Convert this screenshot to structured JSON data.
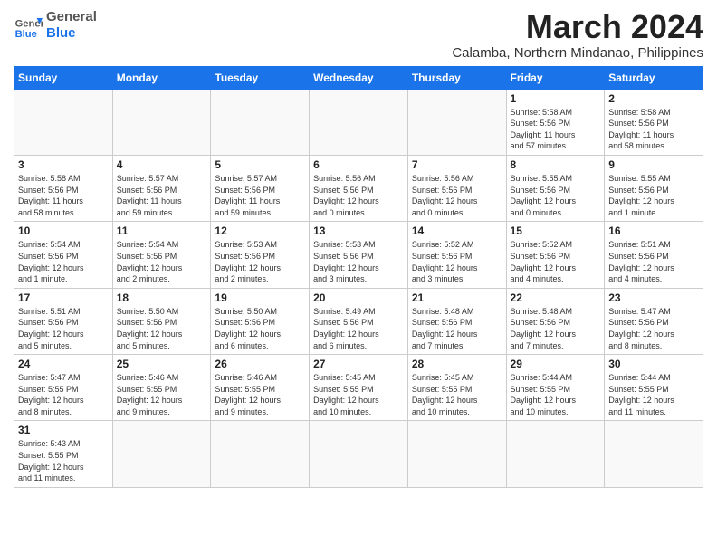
{
  "header": {
    "logo_general": "General",
    "logo_blue": "Blue",
    "month": "March 2024",
    "location": "Calamba, Northern Mindanao, Philippines"
  },
  "weekdays": [
    "Sunday",
    "Monday",
    "Tuesday",
    "Wednesday",
    "Thursday",
    "Friday",
    "Saturday"
  ],
  "weeks": [
    [
      {
        "day": "",
        "info": ""
      },
      {
        "day": "",
        "info": ""
      },
      {
        "day": "",
        "info": ""
      },
      {
        "day": "",
        "info": ""
      },
      {
        "day": "",
        "info": ""
      },
      {
        "day": "1",
        "info": "Sunrise: 5:58 AM\nSunset: 5:56 PM\nDaylight: 11 hours\nand 57 minutes."
      },
      {
        "day": "2",
        "info": "Sunrise: 5:58 AM\nSunset: 5:56 PM\nDaylight: 11 hours\nand 58 minutes."
      }
    ],
    [
      {
        "day": "3",
        "info": "Sunrise: 5:58 AM\nSunset: 5:56 PM\nDaylight: 11 hours\nand 58 minutes."
      },
      {
        "day": "4",
        "info": "Sunrise: 5:57 AM\nSunset: 5:56 PM\nDaylight: 11 hours\nand 59 minutes."
      },
      {
        "day": "5",
        "info": "Sunrise: 5:57 AM\nSunset: 5:56 PM\nDaylight: 11 hours\nand 59 minutes."
      },
      {
        "day": "6",
        "info": "Sunrise: 5:56 AM\nSunset: 5:56 PM\nDaylight: 12 hours\nand 0 minutes."
      },
      {
        "day": "7",
        "info": "Sunrise: 5:56 AM\nSunset: 5:56 PM\nDaylight: 12 hours\nand 0 minutes."
      },
      {
        "day": "8",
        "info": "Sunrise: 5:55 AM\nSunset: 5:56 PM\nDaylight: 12 hours\nand 0 minutes."
      },
      {
        "day": "9",
        "info": "Sunrise: 5:55 AM\nSunset: 5:56 PM\nDaylight: 12 hours\nand 1 minute."
      }
    ],
    [
      {
        "day": "10",
        "info": "Sunrise: 5:54 AM\nSunset: 5:56 PM\nDaylight: 12 hours\nand 1 minute."
      },
      {
        "day": "11",
        "info": "Sunrise: 5:54 AM\nSunset: 5:56 PM\nDaylight: 12 hours\nand 2 minutes."
      },
      {
        "day": "12",
        "info": "Sunrise: 5:53 AM\nSunset: 5:56 PM\nDaylight: 12 hours\nand 2 minutes."
      },
      {
        "day": "13",
        "info": "Sunrise: 5:53 AM\nSunset: 5:56 PM\nDaylight: 12 hours\nand 3 minutes."
      },
      {
        "day": "14",
        "info": "Sunrise: 5:52 AM\nSunset: 5:56 PM\nDaylight: 12 hours\nand 3 minutes."
      },
      {
        "day": "15",
        "info": "Sunrise: 5:52 AM\nSunset: 5:56 PM\nDaylight: 12 hours\nand 4 minutes."
      },
      {
        "day": "16",
        "info": "Sunrise: 5:51 AM\nSunset: 5:56 PM\nDaylight: 12 hours\nand 4 minutes."
      }
    ],
    [
      {
        "day": "17",
        "info": "Sunrise: 5:51 AM\nSunset: 5:56 PM\nDaylight: 12 hours\nand 5 minutes."
      },
      {
        "day": "18",
        "info": "Sunrise: 5:50 AM\nSunset: 5:56 PM\nDaylight: 12 hours\nand 5 minutes."
      },
      {
        "day": "19",
        "info": "Sunrise: 5:50 AM\nSunset: 5:56 PM\nDaylight: 12 hours\nand 6 minutes."
      },
      {
        "day": "20",
        "info": "Sunrise: 5:49 AM\nSunset: 5:56 PM\nDaylight: 12 hours\nand 6 minutes."
      },
      {
        "day": "21",
        "info": "Sunrise: 5:48 AM\nSunset: 5:56 PM\nDaylight: 12 hours\nand 7 minutes."
      },
      {
        "day": "22",
        "info": "Sunrise: 5:48 AM\nSunset: 5:56 PM\nDaylight: 12 hours\nand 7 minutes."
      },
      {
        "day": "23",
        "info": "Sunrise: 5:47 AM\nSunset: 5:56 PM\nDaylight: 12 hours\nand 8 minutes."
      }
    ],
    [
      {
        "day": "24",
        "info": "Sunrise: 5:47 AM\nSunset: 5:55 PM\nDaylight: 12 hours\nand 8 minutes."
      },
      {
        "day": "25",
        "info": "Sunrise: 5:46 AM\nSunset: 5:55 PM\nDaylight: 12 hours\nand 9 minutes."
      },
      {
        "day": "26",
        "info": "Sunrise: 5:46 AM\nSunset: 5:55 PM\nDaylight: 12 hours\nand 9 minutes."
      },
      {
        "day": "27",
        "info": "Sunrise: 5:45 AM\nSunset: 5:55 PM\nDaylight: 12 hours\nand 10 minutes."
      },
      {
        "day": "28",
        "info": "Sunrise: 5:45 AM\nSunset: 5:55 PM\nDaylight: 12 hours\nand 10 minutes."
      },
      {
        "day": "29",
        "info": "Sunrise: 5:44 AM\nSunset: 5:55 PM\nDaylight: 12 hours\nand 10 minutes."
      },
      {
        "day": "30",
        "info": "Sunrise: 5:44 AM\nSunset: 5:55 PM\nDaylight: 12 hours\nand 11 minutes."
      }
    ],
    [
      {
        "day": "31",
        "info": "Sunrise: 5:43 AM\nSunset: 5:55 PM\nDaylight: 12 hours\nand 11 minutes."
      },
      {
        "day": "",
        "info": ""
      },
      {
        "day": "",
        "info": ""
      },
      {
        "day": "",
        "info": ""
      },
      {
        "day": "",
        "info": ""
      },
      {
        "day": "",
        "info": ""
      },
      {
        "day": "",
        "info": ""
      }
    ]
  ]
}
